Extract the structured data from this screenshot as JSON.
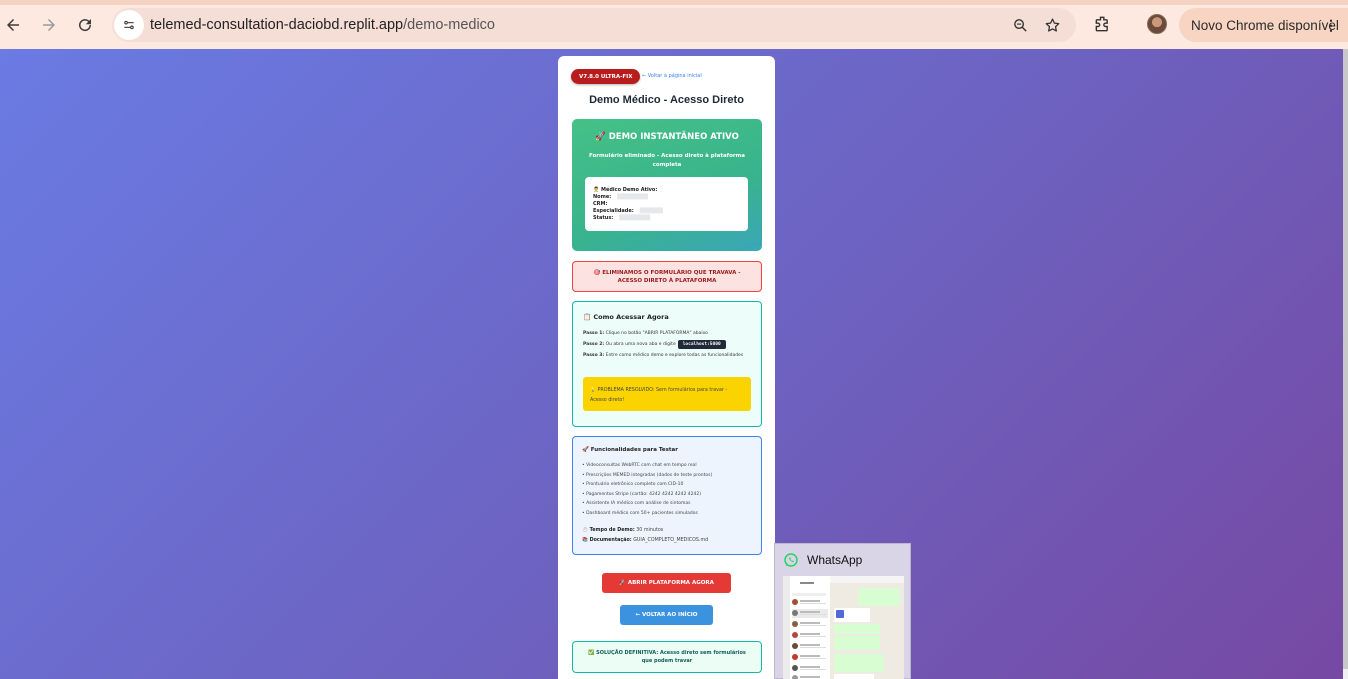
{
  "browser": {
    "url_domain": "telemed-consultation-daciobd.replit.app",
    "url_path": "/demo-medico",
    "update_label": "Novo Chrome disponível"
  },
  "page": {
    "version_badge": "V7.8.0 ULTRA-FIX",
    "back_link": "← Voltar à página inicial",
    "title": "Demo Médico - Acesso Direto",
    "active_title": "🚀 DEMO INSTANTÂNEO ATIVO",
    "active_subtitle": "Formulário eliminado - Acesso direto à plataforma completa",
    "info": {
      "heading": "👨‍⚕️ Médico Demo Ativo:",
      "nome_label": "Nome:",
      "crm_label": "CRM:",
      "especialidade_label": "Especialidade:",
      "status_label": "Status:"
    },
    "alert": "🎯 ELIMINAMOS O FORMULÁRIO QUE TRAVAVA - ACESSO DIRETO À PLATAFORMA",
    "steps": {
      "title": "📋 Como Acessar Agora",
      "step1_label": "Passo 1:",
      "step1_text": " Clique no botão \"ABRIR PLATAFORMA\" abaixo",
      "step2_label": "Passo 2:",
      "step2_text": " Ou abra uma nova aba e digite",
      "step2_code": "localhost:5000",
      "step3_label": "Passo 3:",
      "step3_text": " Entre como médico demo e explore todas as funcionalidades",
      "problem": "💡 PROBLEMA RESOLVIDO: Sem formulários para travar - Acesso direto!"
    },
    "features": {
      "title": "🚀 Funcionalidades para Testar",
      "items": [
        "• Videoconsultas WebRTC com chat em tempo real",
        "• Prescrições MEMED integradas (dados de teste prontos)",
        "• Prontuário eletrônico completo com CID-10",
        "• Pagamentos Stripe (cartão: 4242 4242 4242 4242)",
        "• Assistente IA médico com análise de sintomas",
        "• Dashboard médico com 50+ pacientes simulados"
      ],
      "time_label": "⏱️ Tempo de Demo:",
      "time_value": " 30 minutos",
      "doc_label": "📚 Documentação:",
      "doc_value": " GUIA_COMPLETO_MEDICOS.md"
    },
    "open_button": "🚀 ABRIR PLATAFORMA AGORA",
    "back_button": "← VOLTAR AO INÍCIO",
    "solution": "✅ SOLUÇÃO DEFINITIVA: Acesso direto sem formulários que podem travar"
  },
  "taskbar_preview": {
    "app_name": "WhatsApp"
  },
  "colors": {
    "accent_red": "#e53935",
    "accent_blue": "#3b93e0",
    "whatsapp_green": "#25d366"
  }
}
